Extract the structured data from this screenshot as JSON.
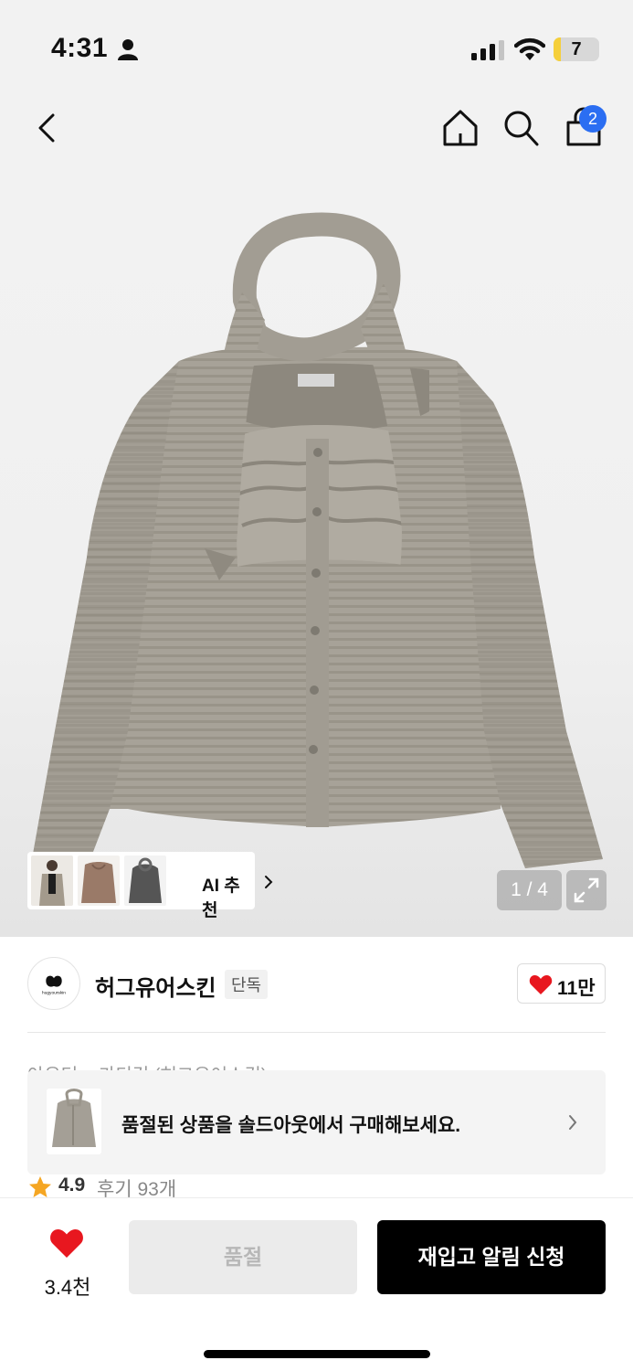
{
  "status_bar": {
    "time": "4:31",
    "battery_level": "7"
  },
  "nav": {
    "cart_count": "2"
  },
  "gallery": {
    "ai_label": "AI 추천",
    "counter": "1 / 4",
    "hero_label": "hug your skin"
  },
  "brand": {
    "name": "허그유어스킨",
    "badge": "단독",
    "logo_text": "hugyourskin",
    "like_count": "11만"
  },
  "product": {
    "breadcrumb": "아우터 > 가디건 (허그유어스킨)",
    "soldout_notice": "품절된 상품을 솔드아웃에서 구매해보세요.",
    "rating": "4.9",
    "reviews": "후기 93개"
  },
  "bottom_bar": {
    "wish_count": "3.4천",
    "soldout_label": "품절",
    "restock_label": "재입고 알림 신청"
  },
  "colors": {
    "accent_blue": "#2b6ef2",
    "heart_red": "#e8171f",
    "star_orange": "#f5a623",
    "knit_beige": "#a49f96"
  }
}
